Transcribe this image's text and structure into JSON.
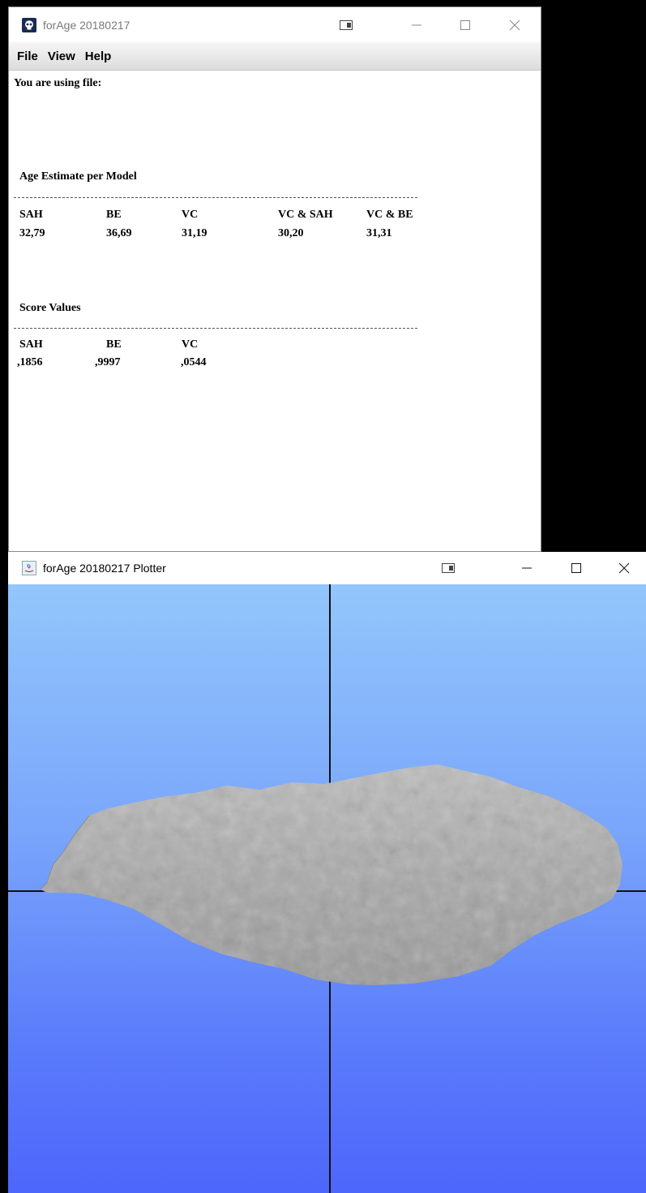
{
  "main_window": {
    "title": "forAge 20180217",
    "menu": [
      "File",
      "View",
      "Help"
    ],
    "file_label": "You are using file:",
    "age_section": {
      "title": "Age Estimate per Model",
      "headers": [
        "SAH",
        "BE",
        "VC",
        "VC & SAH",
        "VC & BE"
      ],
      "values": [
        "32,79",
        "36,69",
        "31,19",
        "30,20",
        "31,31"
      ]
    },
    "score_section": {
      "title": "Score Values",
      "headers": [
        "SAH",
        "BE",
        "VC"
      ],
      "values": [
        ",1856",
        ",9997",
        ",0544"
      ]
    }
  },
  "plotter_window": {
    "title": "forAge 20180217 Plotter",
    "background_gradient": [
      "#93c6fb",
      "#4d66fb"
    ],
    "object_color": "#a9a9a9",
    "axis_color": "#111111"
  }
}
